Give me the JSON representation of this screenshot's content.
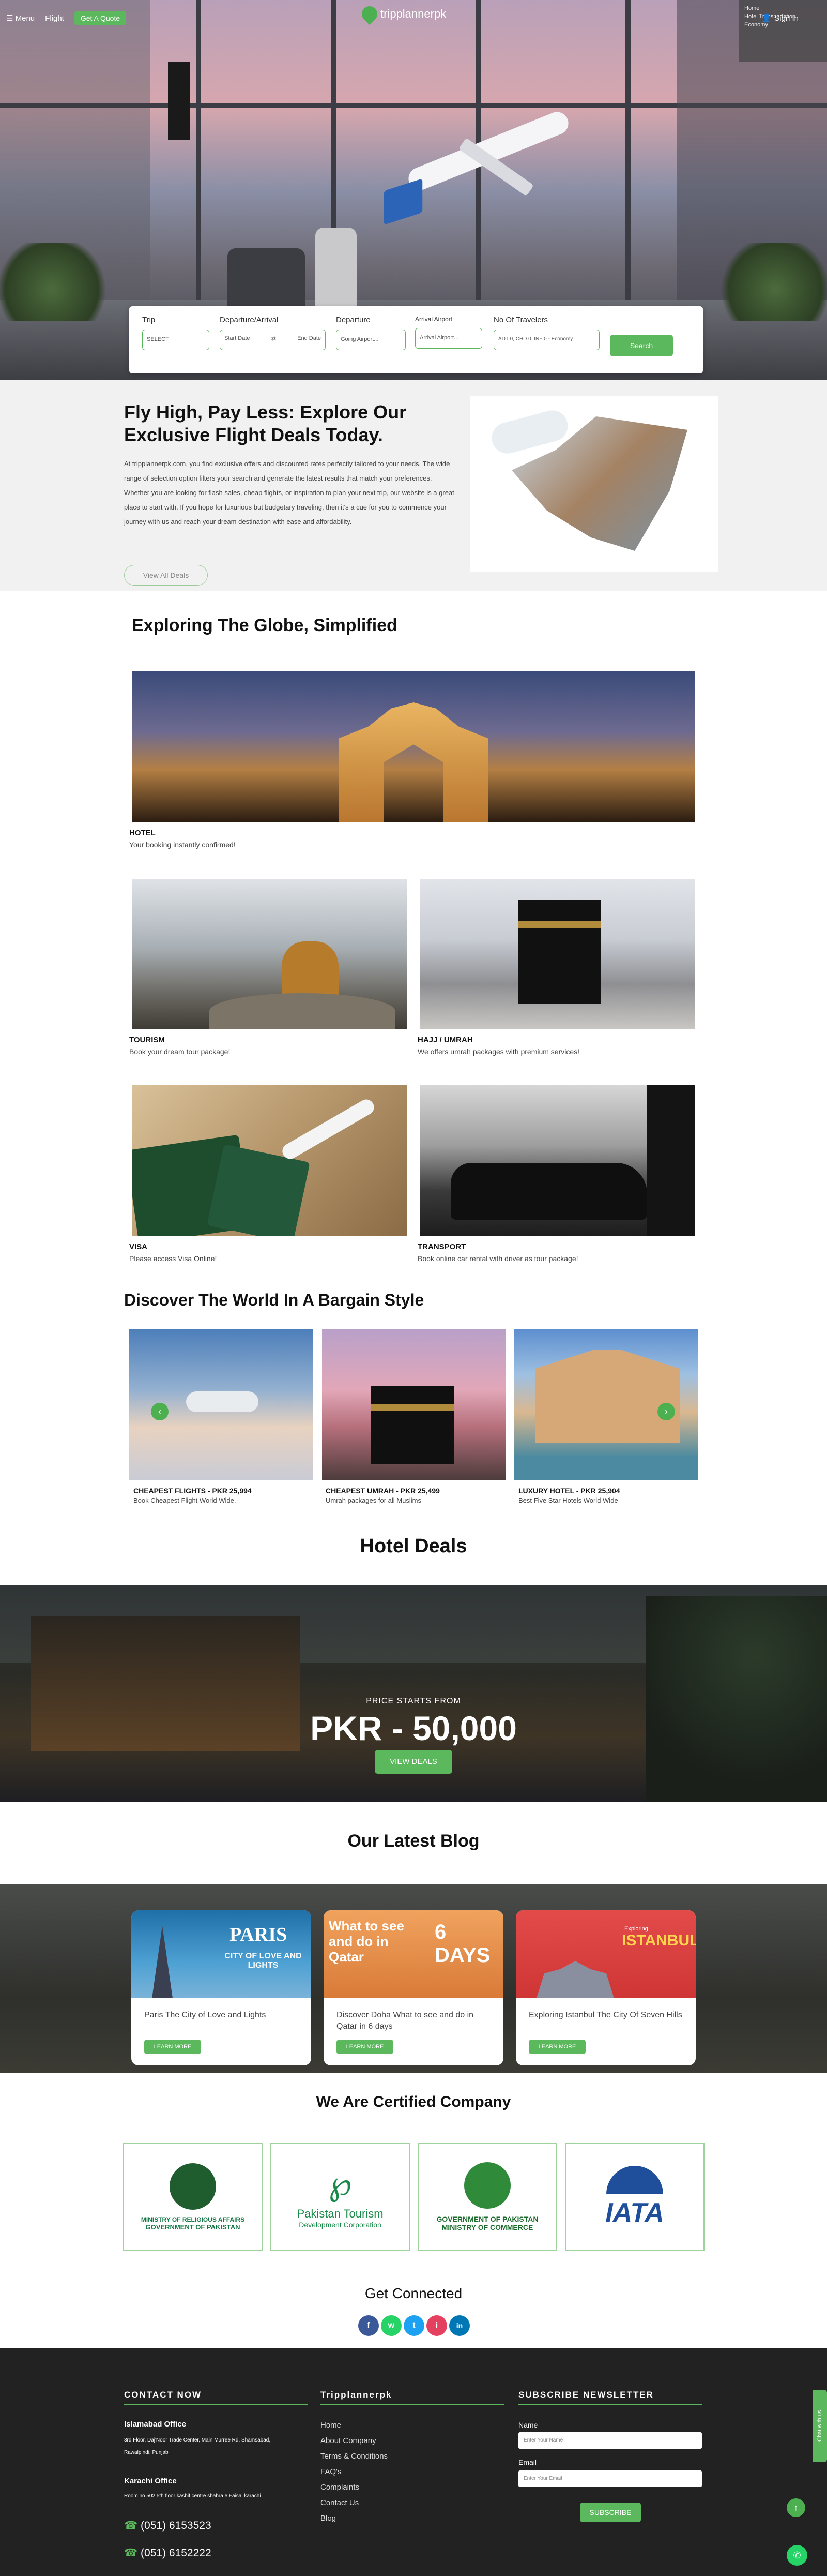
{
  "nav": {
    "menu_label": "Menu",
    "flight_label": "Flight",
    "quote_label": "Get A Quote",
    "logo_text": "tripplannerpk",
    "signin_label": "Sign In"
  },
  "float_panel": {
    "line1": "Home",
    "line2": "Hotel Transportation",
    "line3": "Economy"
  },
  "search": {
    "trip_label": "Trip",
    "trip_value": "SELECT",
    "dep_arr_label": "Departure/Arrival",
    "start_date": "Start Date",
    "end_date": "End Date",
    "departure_label": "Departure",
    "departure_placeholder": "Going Airport...",
    "arrival_label": "Arrival Airport",
    "arrival_placeholder": "Arrival Airport...",
    "travelers_label": "No Of Travelers",
    "travelers_value": "ADT 0, CHD 0, INF 0 - Economy",
    "search_button": "Search"
  },
  "intro": {
    "title": "Fly High, Pay Less: Explore Our Exclusive Flight Deals Today.",
    "body": "At tripplannerpk.com, you find exclusive offers and discounted rates perfectly tailored to your needs. The wide range of selection option filters your search and generate the latest results that match your preferences. Whether you are looking for flash sales, cheap flights, or inspiration to plan your next trip, our website is a great place to start with. If you hope for luxurious but budgetary traveling, then it's a cue for you to commence your journey with us and reach your dream destination with ease and affordability.",
    "button": "View All Deals"
  },
  "explore": {
    "title": "Exploring The Globe, Simplified",
    "cards": [
      {
        "title": "HOTEL",
        "sub": "Your booking instantly confirmed!"
      },
      {
        "title": "TOURISM",
        "sub": "Book your dream tour package!"
      },
      {
        "title": "HAJJ / UMRAH",
        "sub": "We offers umrah packages with premium services!"
      },
      {
        "title": "VISA",
        "sub": "Please access Visa Online!"
      },
      {
        "title": "TRANSPORT",
        "sub": "Book online car rental with driver as tour package!"
      }
    ]
  },
  "bargain": {
    "title": "Discover The World In A Bargain Style",
    "cards": [
      {
        "title": "CHEAPEST FLIGHTS - PKR 25,994",
        "sub": "Book Cheapest Flight World Wide."
      },
      {
        "title": "CHEAPEST UMRAH - PKR 25,499",
        "sub": "Umrah packages for all Muslims"
      },
      {
        "title": "LUXURY HOTEL - PKR 25,904",
        "sub": "Best Five Star Hotels World Wide"
      }
    ],
    "prev_arrow": "‹",
    "next_arrow": "›"
  },
  "hotel": {
    "title": "Hotel Deals",
    "price_small": "PRICE STARTS FROM",
    "price_big": "PKR - 50,000",
    "button": "VIEW DEALS"
  },
  "blog": {
    "title": "Our Latest Blog",
    "posts": [
      {
        "text": "Paris The City of Love and Lights",
        "art": "PARIS",
        "art_sub": "CITY OF LOVE AND LIGHTS",
        "button": "LEARN MORE"
      },
      {
        "text": "Discover Doha What to see and do in Qatar in 6 days",
        "art": "What to see and do in Qatar",
        "art_sub": "6 DAYS",
        "button": "LEARN MORE"
      },
      {
        "text": "Exploring Istanbul The City Of Seven Hills",
        "art": "ISTANBUL",
        "art_sub": "Exploring",
        "button": "LEARN MORE"
      }
    ]
  },
  "certified": {
    "title": "We Are Certified Company",
    "items": [
      {
        "line1": "MINISTRY OF RELIGIOUS AFFAIRS",
        "line2": "GOVERNMENT OF PAKISTAN"
      },
      {
        "line1": "Pakistan Tourism",
        "line2": "Development Corporation"
      },
      {
        "line1": "GOVERNMENT OF PAKISTAN",
        "line2": "MINISTRY OF COMMERCE"
      },
      {
        "line1": "IATA",
        "line2": ""
      }
    ]
  },
  "connected": {
    "title": "Get Connected",
    "icons": [
      "f",
      "w",
      "t",
      "i",
      "in"
    ]
  },
  "footer": {
    "contact_head": "CONTACT NOW",
    "isl_head": "Islamabad Office",
    "isl_addr1": "3rd Floor, Daj'Noor Trade Center, Main Murree Rd, Shamsabad,",
    "isl_addr2": "Rawalpindi, Punjab",
    "khi_head": "Karachi Office",
    "khi_addr": "Room no 502 5th floor kashif centre shahra e Faisal karachi",
    "phone1": "(051) 6153523",
    "phone2": "(051) 6152222",
    "links_head": "Tripplannerpk",
    "links": [
      "Home",
      "About Company",
      "Terms & Conditions",
      "FAQ's",
      "Complaints",
      "Contact Us",
      "Blog"
    ],
    "news_head": "SUBSCRIBE NEWSLETTER",
    "name_label": "Name",
    "name_placeholder": "Enter Your Name",
    "email_label": "Email",
    "email_placeholder": "Enter Your Email",
    "subscribe_button": "SUBSCRIBE",
    "chat_label": "Chat with us"
  },
  "colors": {
    "accent": "#5cb85c",
    "footer_bg": "#222222",
    "intro_bg": "#f1f1f1"
  }
}
